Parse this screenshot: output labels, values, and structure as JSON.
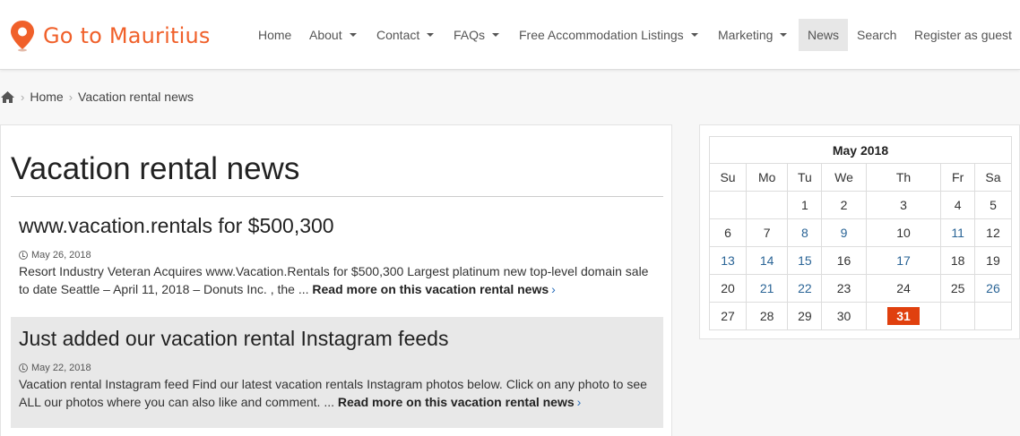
{
  "header": {
    "logo_text": "Go to Mauritius",
    "brand_color": "#f0602a",
    "nav": [
      {
        "label": "Home",
        "dropdown": false,
        "active": false
      },
      {
        "label": "About",
        "dropdown": true,
        "active": false
      },
      {
        "label": "Contact",
        "dropdown": true,
        "active": false
      },
      {
        "label": "FAQs",
        "dropdown": true,
        "active": false
      },
      {
        "label": "Free Accommodation Listings",
        "dropdown": true,
        "active": false
      },
      {
        "label": "Marketing",
        "dropdown": true,
        "active": false
      },
      {
        "label": "News",
        "dropdown": false,
        "active": true
      },
      {
        "label": "Search",
        "dropdown": false,
        "active": false
      },
      {
        "label": "Register as guest",
        "dropdown": false,
        "active": false
      }
    ]
  },
  "breadcrumb": {
    "home_icon": "home-icon",
    "items": [
      "Home",
      "Vacation rental news"
    ]
  },
  "main": {
    "page_title": "Vacation rental news",
    "posts": [
      {
        "title": "www.vacation.rentals for $500,300",
        "date": "May 26, 2018",
        "excerpt": "Resort Industry Veteran Acquires www.Vacation.Rentals for $500,300 Largest platinum new top-level domain sale to date Seattle – April 11, 2018 –   Donuts Inc. , the ... ",
        "read_more": "Read more on this vacation rental news"
      },
      {
        "title": "Just added our vacation rental Instagram feeds",
        "date": "May 22, 2018",
        "excerpt": "Vacation rental Instagram feed Find our latest vacation rentals Instagram photos below. Click on any photo to see ALL our photos where you can also like and comment. ... ",
        "read_more": "Read more on this vacation rental news"
      }
    ]
  },
  "calendar": {
    "caption": "May 2018",
    "weekdays": [
      "Su",
      "Mo",
      "Tu",
      "We",
      "Th",
      "Fr",
      "Sa"
    ],
    "weeks": [
      [
        "",
        "",
        "1",
        "2",
        "3",
        "4",
        "5"
      ],
      [
        "6",
        "7",
        "8",
        "9",
        "10",
        "11",
        "12"
      ],
      [
        "13",
        "14",
        "15",
        "16",
        "17",
        "18",
        "19"
      ],
      [
        "20",
        "21",
        "22",
        "23",
        "24",
        "25",
        "26"
      ],
      [
        "27",
        "28",
        "29",
        "30",
        "31",
        "",
        ""
      ]
    ],
    "linked_days": [
      "8",
      "9",
      "11",
      "13",
      "14",
      "15",
      "17",
      "21",
      "22",
      "26"
    ],
    "today": "31",
    "today_color": "#e0400e"
  }
}
